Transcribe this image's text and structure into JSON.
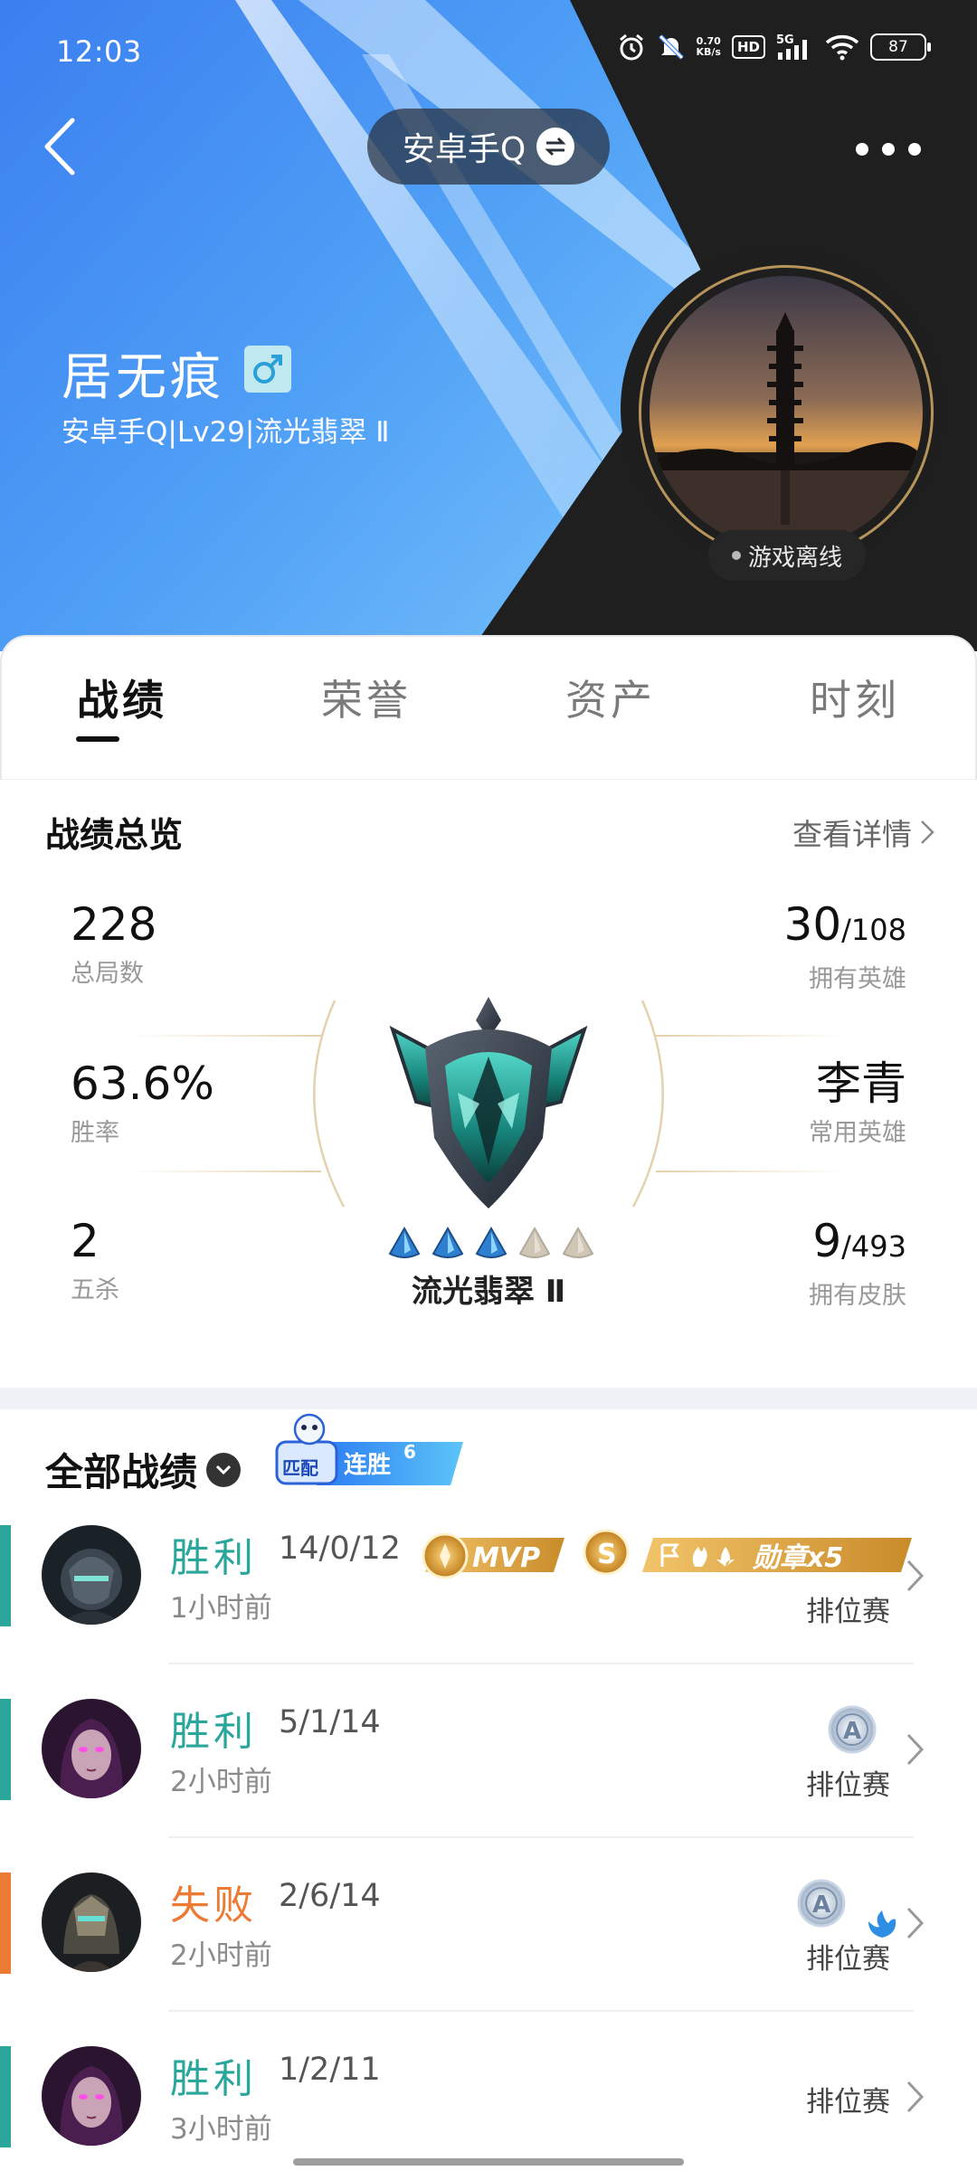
{
  "status_bar": {
    "time": "12:03",
    "net_speed_value": "0.70",
    "net_speed_unit": "KB/s",
    "hd": "HD",
    "signal": "5G",
    "battery": "87"
  },
  "header": {
    "account_name": "安卓手Q",
    "player_name": "居无痕",
    "player_sub": "安卓手Q|Lv29|流光翡翠 Ⅱ",
    "online_status": "游戏离线"
  },
  "tabs": [
    {
      "label": "战绩",
      "active": true
    },
    {
      "label": "荣誉",
      "active": false
    },
    {
      "label": "资产",
      "active": false
    },
    {
      "label": "时刻",
      "active": false
    }
  ],
  "overview": {
    "title": "战绩总览",
    "detail_link": "查看详情",
    "total_games": {
      "value": "228",
      "label": "总局数"
    },
    "win_rate": {
      "value": "63.6%",
      "label": "胜率"
    },
    "pentakills": {
      "value": "2",
      "label": "五杀"
    },
    "heroes_owned": {
      "value": "30",
      "total": "/108",
      "label": "拥有英雄"
    },
    "common_hero": {
      "value": "李青",
      "label": "常用英雄"
    },
    "skins_owned": {
      "value": "9",
      "total": "/493",
      "label": "拥有皮肤"
    },
    "rank": {
      "name": "流光翡翠 Ⅱ",
      "stars_filled": 3,
      "stars_total": 5
    }
  },
  "matches_section": {
    "title": "全部战绩",
    "streak_badge": {
      "mode": "匹配",
      "label": "连胜",
      "count": "6"
    }
  },
  "matches": [
    {
      "result": "胜利",
      "kda": "14/0/12",
      "time": "1小时前",
      "mode": "排位赛",
      "outcome": "win",
      "badges": [
        "MVP",
        "S",
        "勋章x5"
      ]
    },
    {
      "result": "胜利",
      "kda": "5/1/14",
      "time": "2小时前",
      "mode": "排位赛",
      "outcome": "win",
      "badges": [
        "A"
      ]
    },
    {
      "result": "失败",
      "kda": "2/6/14",
      "time": "2小时前",
      "mode": "排位赛",
      "outcome": "lose",
      "badges": [
        "A"
      ]
    },
    {
      "result": "胜利",
      "kda": "1/2/11",
      "time": "3小时前",
      "mode": "排位赛",
      "outcome": "win",
      "badges": []
    }
  ],
  "colors": {
    "win": "#2aa69b",
    "lose": "#ec7a32",
    "header_blue": "#3f86ee",
    "header_dark": "#1f1f1f",
    "gold": "#d9a441"
  },
  "icons": [
    "back-arrow",
    "switch-account",
    "more-dots",
    "male-gender",
    "chevron-right",
    "dropdown-caret",
    "rank-emblem"
  ]
}
